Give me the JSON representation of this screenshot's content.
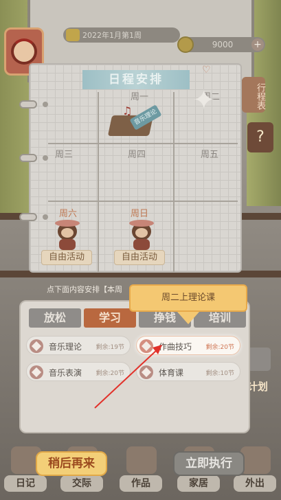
{
  "hud": {
    "date": "2022年1月第1周",
    "coins": "9000",
    "plus_label": "+"
  },
  "side": {
    "schedule_label": "行程表",
    "help_label": "?",
    "plan_label": "计划"
  },
  "schedule": {
    "title": "日程安排",
    "days": [
      "周一",
      "周二",
      "周三",
      "周四",
      "周五",
      "周六",
      "周日"
    ],
    "monday_tag": "音乐理论",
    "weekend_activity": "自由活动"
  },
  "hint": "点下面内容安排【本周",
  "tabs": [
    {
      "label": "放松",
      "active": false
    },
    {
      "label": "学习",
      "active": true
    },
    {
      "label": "挣钱",
      "active": false
    },
    {
      "label": "培训",
      "active": false
    }
  ],
  "courses": [
    {
      "name": "音乐理论",
      "remaining": "剩余:19节",
      "highlight": false
    },
    {
      "name": "作曲技巧",
      "remaining": "剩余:20节",
      "highlight": true
    },
    {
      "name": "音乐表演",
      "remaining": "剩余:20节",
      "highlight": false
    },
    {
      "name": "体育课",
      "remaining": "剩余:10节",
      "highlight": false
    }
  ],
  "tooltip": "周二上理论课",
  "actions": {
    "later": "稍后再来",
    "execute": "立即执行"
  },
  "nav": [
    {
      "label": "日记",
      "icon": "diary-icon"
    },
    {
      "label": "交际",
      "icon": "social-icon"
    },
    {
      "label": "作品",
      "icon": "works-icon"
    },
    {
      "label": "家居",
      "icon": "home-icon"
    },
    {
      "label": "外出",
      "icon": "outing-icon"
    }
  ]
}
